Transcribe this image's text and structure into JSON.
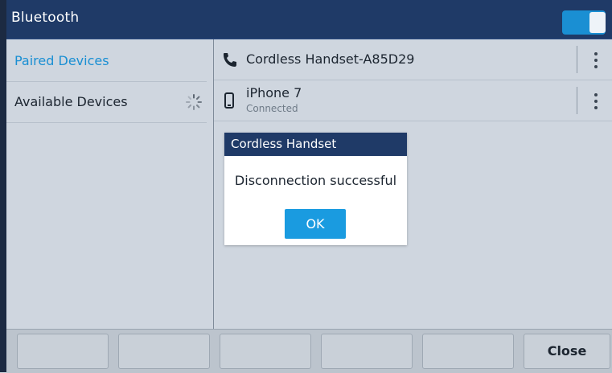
{
  "title": "Bluetooth",
  "bluetooth_toggle": {
    "on": true,
    "accent": "#1a8fd3"
  },
  "nav": {
    "items": [
      {
        "label": "Paired Devices",
        "selected": true
      },
      {
        "label": "Available Devices",
        "selected": false,
        "icon": "loading-spinner-icon"
      }
    ]
  },
  "devices": [
    {
      "name": "Cordless Handset-A85D29",
      "status": "",
      "icon": "phone-handset-icon"
    },
    {
      "name": "iPhone 7",
      "status": "Connected",
      "icon": "mobile-phone-icon"
    }
  ],
  "dialog": {
    "title": "Cordless Handset",
    "message": "Disconnection successful",
    "ok_label": "OK"
  },
  "softkeys": [
    "",
    "",
    "",
    "",
    "",
    "Close"
  ],
  "colors": {
    "header": "#1f3a67",
    "accent": "#1a8fd3",
    "background": "#cfd6df"
  }
}
